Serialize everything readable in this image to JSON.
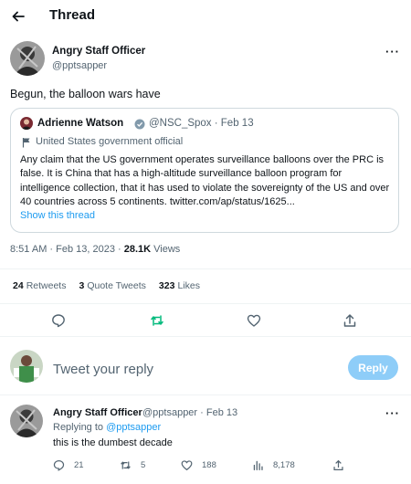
{
  "header": {
    "title": "Thread",
    "back_icon": "arrow-left-icon"
  },
  "tweet": {
    "author_name": "Angry Staff Officer",
    "author_handle": "@pptsapper",
    "text": "Begun, the balloon wars have",
    "quote": {
      "name": "Adrienne Watson",
      "meta": "@NSC_Spox · Feb 13",
      "label": "United States government official",
      "body": "Any claim that the US government operates surveillance balloons over the PRC is false. It is China that has a high-altitude surveillance balloon program for intelligence collection, that it has used to violate the sovereignty of the US and over 40 countries across 5 continents. twitter.com/ap/status/1625...",
      "show_thread": "Show this thread"
    },
    "time": "8:51 AM · Feb 13, 2023 · ",
    "views_count": "28.1K",
    "views_label": " Views",
    "stats": {
      "retweets_count": "24",
      "retweets_label": "Retweets",
      "quotes_count": "3",
      "quotes_label": "Quote Tweets",
      "likes_count": "323",
      "likes_label": "Likes"
    }
  },
  "composer": {
    "placeholder": "Tweet your reply",
    "button": "Reply"
  },
  "reply": {
    "author_name": "Angry Staff Officer",
    "meta": "@pptsapper · Feb 13",
    "replying_prefix": "Replying to ",
    "replying_handle": "@pptsapper",
    "text": "this is the dumbest decade",
    "counts": {
      "replies": "21",
      "retweets": "5",
      "likes": "188",
      "views": "8,178"
    }
  },
  "colors": {
    "accent": "#1d9bf0",
    "muted": "#536471",
    "retweet_green": "#00ba7c",
    "reply_button": "#8ecdf8"
  }
}
